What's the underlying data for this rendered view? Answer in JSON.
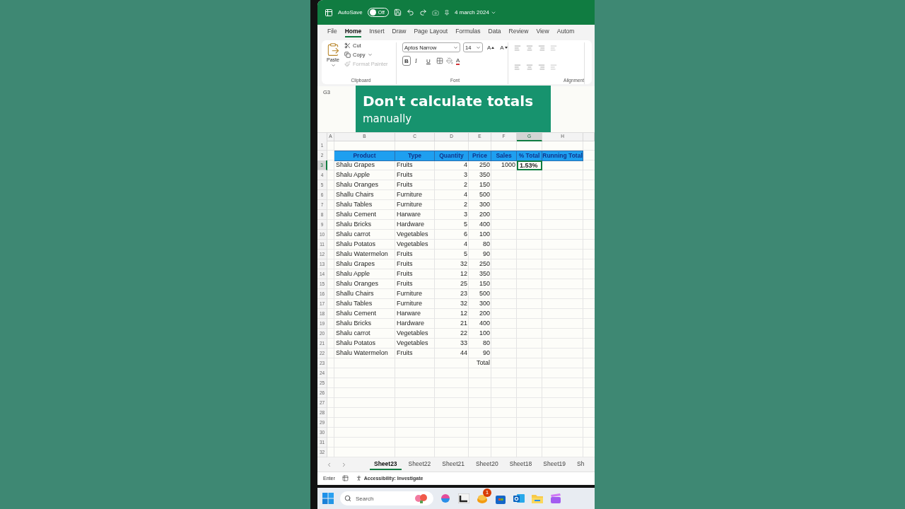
{
  "title_bar": {
    "autosave_label": "AutoSave",
    "autosave": {
      "label": "Off",
      "on": false
    },
    "title": "4 march 2024"
  },
  "ribbon_tabs": [
    {
      "label": "File",
      "selected": false
    },
    {
      "label": "Home",
      "selected": true
    },
    {
      "label": "Insert",
      "selected": false
    },
    {
      "label": "Draw",
      "selected": false
    },
    {
      "label": "Page Layout",
      "selected": false
    },
    {
      "label": "Formulas",
      "selected": false
    },
    {
      "label": "Data",
      "selected": false
    },
    {
      "label": "Review",
      "selected": false
    },
    {
      "label": "View",
      "selected": false
    },
    {
      "label": "Autom",
      "selected": false
    }
  ],
  "ribbon": {
    "clipboard": {
      "paste": "Paste",
      "cut": "Cut",
      "copy": "Copy",
      "format_painter": {
        "label": "Format Painter",
        "disabled": true
      },
      "group_label": "Clipboard"
    },
    "font": {
      "name": "Aptos Narrow",
      "size": "14",
      "grow": "A",
      "shrink": "A",
      "bold": "B",
      "italic": "I",
      "underline": "U",
      "font_color": "A",
      "group_label": "Font"
    },
    "alignment": {
      "group_label": "Alignment"
    }
  },
  "overlay": {
    "title": "Don't calculate totals",
    "subtitle": "manually"
  },
  "sheet": {
    "name_box": "G3",
    "column_headers": [
      {
        "label": "A",
        "selected": false
      },
      {
        "label": "B",
        "selected": false
      },
      {
        "label": "C",
        "selected": false
      },
      {
        "label": "D",
        "selected": false
      },
      {
        "label": "E",
        "selected": false
      },
      {
        "label": "F",
        "selected": false
      },
      {
        "label": "G",
        "selected": true
      },
      {
        "label": "H",
        "selected": false
      }
    ],
    "row_numbers": [
      "1",
      "2",
      "3",
      "4",
      "5",
      "6",
      "7",
      "8",
      "9",
      "10",
      "11",
      "12",
      "13",
      "14",
      "15",
      "16",
      "17",
      "18",
      "19",
      "20",
      "21",
      "22",
      "23",
      "24",
      "25",
      "26",
      "27",
      "28",
      "29",
      "30",
      "31",
      "32"
    ],
    "table": {
      "columns": [
        "Product",
        "Type",
        "Quantity",
        "Price",
        "Sales",
        "% Total",
        "Running Total"
      ],
      "rows": [
        {
          "cells": [
            "Shalu Grapes",
            "Fruits",
            "4",
            "250",
            "1000",
            "1.53%"
          ],
          "selected": true
        },
        {
          "cells": [
            "Shalu Apple",
            "Fruits",
            "3",
            "350"
          ],
          "selected": false
        },
        {
          "cells": [
            "Shalu Oranges",
            "Fruits",
            "2",
            "150"
          ],
          "selected": false
        },
        {
          "cells": [
            "Shallu Chairs",
            "Furniture",
            "4",
            "500"
          ],
          "selected": false
        },
        {
          "cells": [
            "Shalu Tables",
            "Furniture",
            "2",
            "300"
          ],
          "selected": false
        },
        {
          "cells": [
            "Shalu Cement",
            "Harware",
            "3",
            "200"
          ],
          "selected": false
        },
        {
          "cells": [
            "Shalu Bricks",
            "Hardware",
            "5",
            "400"
          ],
          "selected": false
        },
        {
          "cells": [
            "Shalu carrot",
            "Vegetables",
            "6",
            "100"
          ],
          "selected": false
        },
        {
          "cells": [
            "Shalu Potatos",
            "Vegetables",
            "4",
            "80"
          ],
          "selected": false
        },
        {
          "cells": [
            "Shalu Watermelon",
            "Fruits",
            "5",
            "90"
          ],
          "selected": false
        },
        {
          "cells": [
            "Shalu Grapes",
            "Fruits",
            "32",
            "250"
          ],
          "selected": false
        },
        {
          "cells": [
            "Shalu Apple",
            "Fruits",
            "12",
            "350"
          ],
          "selected": false
        },
        {
          "cells": [
            "Shalu Oranges",
            "Fruits",
            "25",
            "150"
          ],
          "selected": false
        },
        {
          "cells": [
            "Shallu Chairs",
            "Furniture",
            "23",
            "500"
          ],
          "selected": false
        },
        {
          "cells": [
            "Shalu Tables",
            "Furniture",
            "32",
            "300"
          ],
          "selected": false
        },
        {
          "cells": [
            "Shalu Cement",
            "Harware",
            "12",
            "200"
          ],
          "selected": false
        },
        {
          "cells": [
            "Shalu Bricks",
            "Hardware",
            "21",
            "400"
          ],
          "selected": false
        },
        {
          "cells": [
            "Shalu carrot",
            "Vegetables",
            "22",
            "100"
          ],
          "selected": false
        },
        {
          "cells": [
            "Shalu Potatos",
            "Vegetables",
            "33",
            "80"
          ],
          "selected": false
        },
        {
          "cells": [
            "Shalu Watermelon",
            "Fruits",
            "44",
            "90"
          ],
          "selected": false
        }
      ]
    },
    "total_label": "Total"
  },
  "sheet_tabs": [
    {
      "label": "Sheet23",
      "selected": true
    },
    {
      "label": "Sheet22",
      "selected": false
    },
    {
      "label": "Sheet21",
      "selected": false
    },
    {
      "label": "Sheet20",
      "selected": false
    },
    {
      "label": "Sheet18",
      "selected": false
    },
    {
      "label": "Sheet19",
      "selected": false
    },
    {
      "label": "Sh",
      "selected": false
    }
  ],
  "status_bar": {
    "mode": "Enter",
    "accessibility": "Accessibility: Investigate"
  },
  "taskbar": {
    "search_placeholder": "Search",
    "badge": "1"
  }
}
